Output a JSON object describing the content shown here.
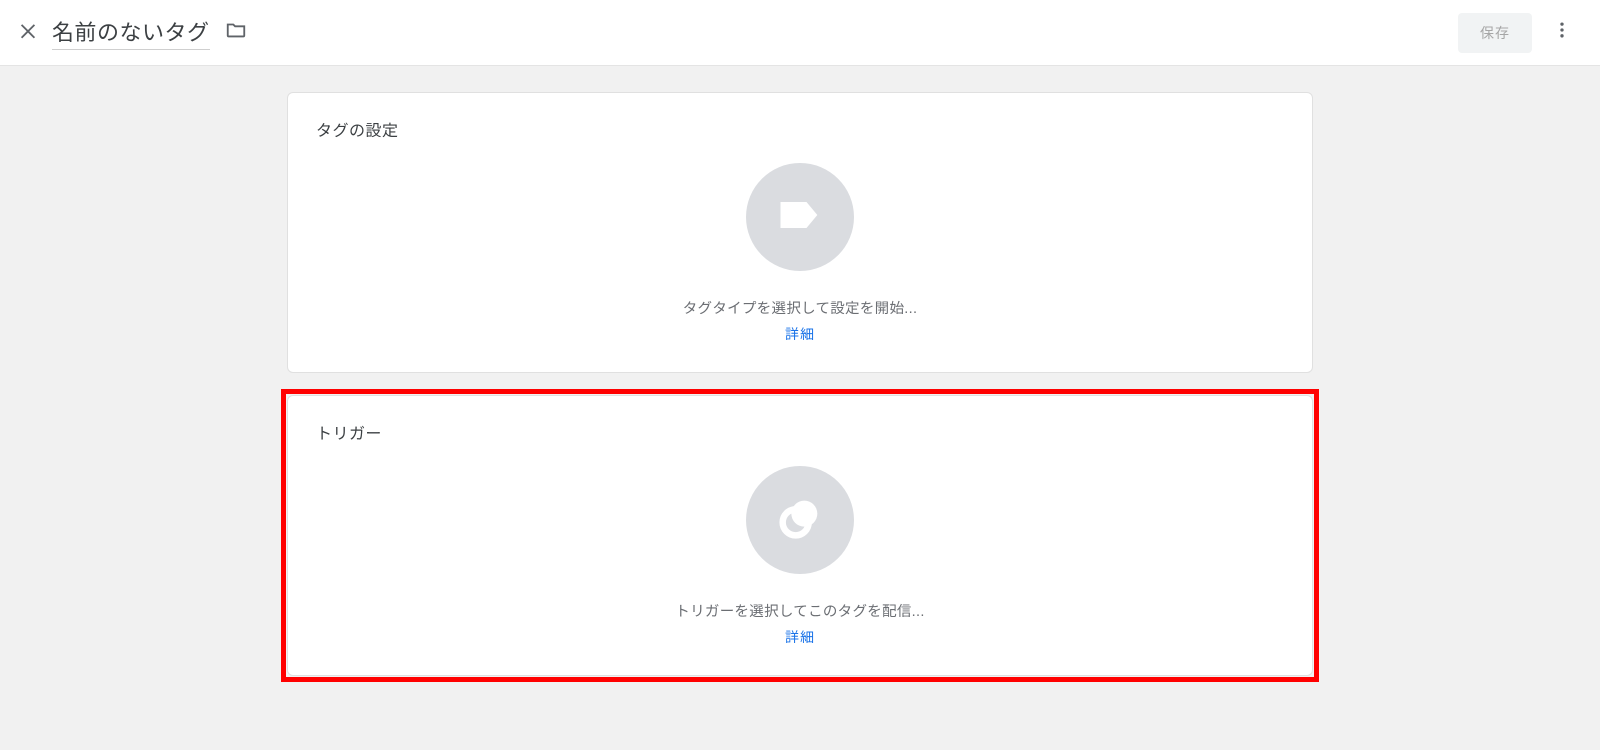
{
  "header": {
    "title": "名前のないタグ",
    "save_label": "保存"
  },
  "cards": {
    "tag_config": {
      "title": "タグの設定",
      "prompt": "タグタイプを選択して設定を開始...",
      "detail": "詳細"
    },
    "trigger": {
      "title": "トリガー",
      "prompt": "トリガーを選択してこのタグを配信...",
      "detail": "詳細"
    }
  }
}
